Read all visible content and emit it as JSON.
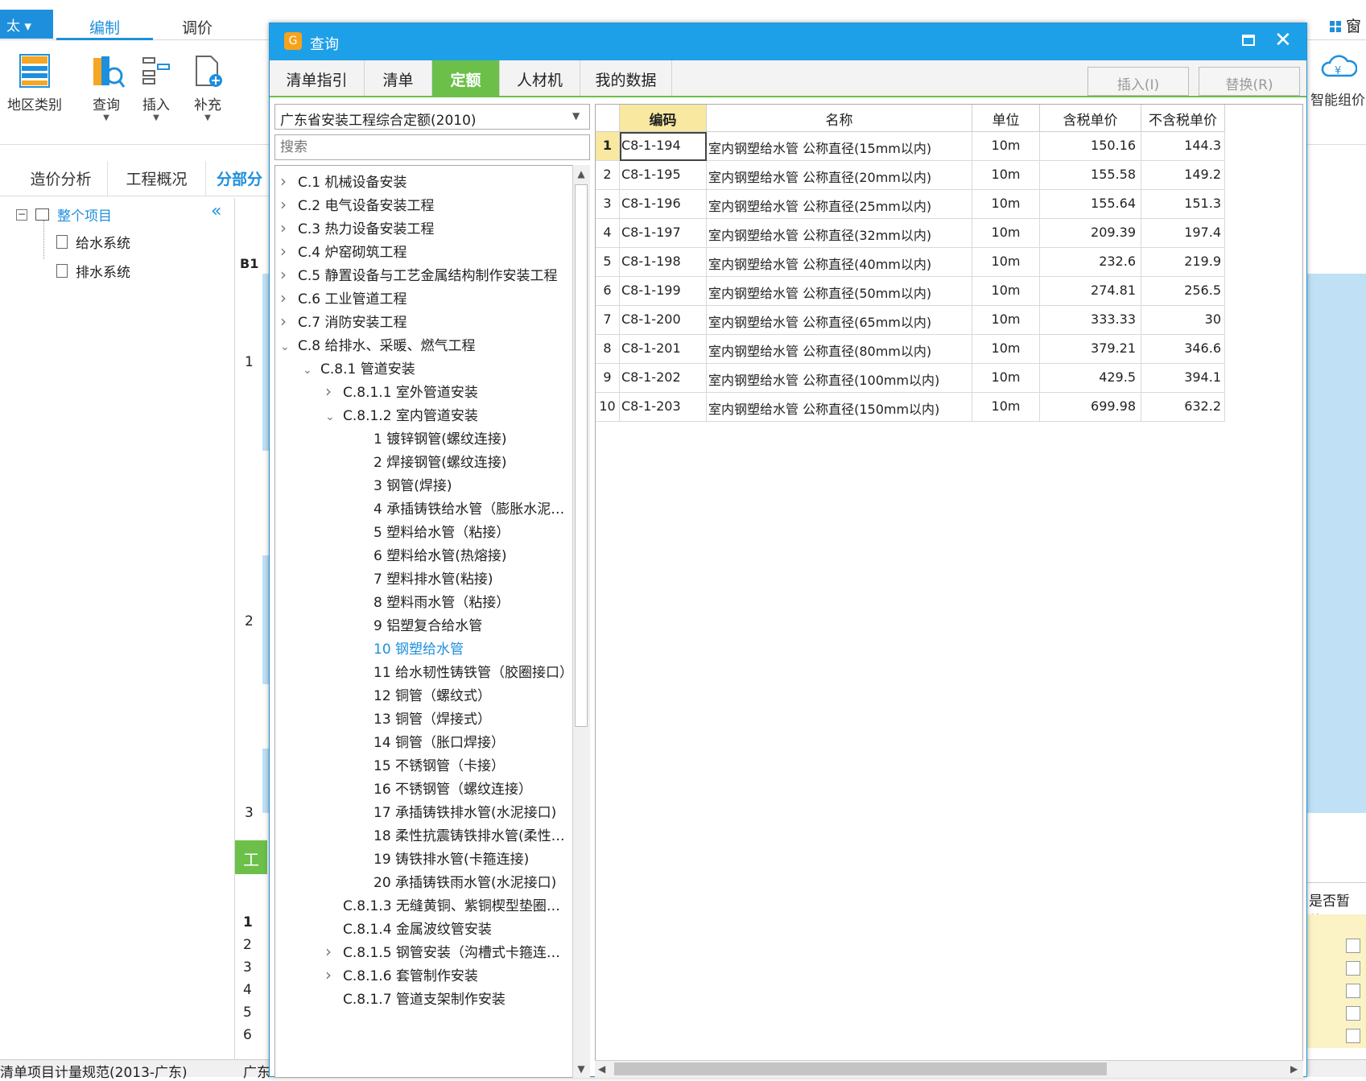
{
  "app": {
    "menu_label": "太 ▾",
    "top_tabs": [
      "编制",
      "调价"
    ],
    "window_label": "窗口",
    "ribbon": {
      "region": "地区类别",
      "query": "查询",
      "insert": "插入",
      "supply": "补充",
      "smart_price": "智能组价"
    },
    "subtabs": [
      "造价分析",
      "工程概况",
      "分部分"
    ],
    "project_tree": {
      "root": "整个项目",
      "children": [
        "给水系统",
        "排水系统"
      ]
    },
    "bg_labels": {
      "b1": "B1",
      "green_tab": "工",
      "right_header": "是否暂估"
    },
    "bg_row_numbers": [
      "1",
      "2",
      "3"
    ],
    "bg_lower_rows": [
      "1",
      "2",
      "3",
      "4",
      "5",
      "6"
    ],
    "status": {
      "spec": "清单项目计量规范(2013-广东)",
      "region": "广东"
    }
  },
  "dialog": {
    "title": "查询",
    "tabs": [
      "清单指引",
      "清单",
      "定额",
      "人材机",
      "我的数据"
    ],
    "active_tab": "定额",
    "buttons": {
      "insert": "插入(I)",
      "replace": "替换(R)"
    },
    "quota_library": "广东省安装工程综合定额(2010)",
    "search_placeholder": "搜索",
    "chapter_tree": [
      {
        "arrow": ">",
        "indent": 0,
        "label": "C.1 机械设备安装"
      },
      {
        "arrow": ">",
        "indent": 0,
        "label": "C.2 电气设备安装工程"
      },
      {
        "arrow": ">",
        "indent": 0,
        "label": "C.3 热力设备安装工程"
      },
      {
        "arrow": ">",
        "indent": 0,
        "label": "C.4 炉窑砌筑工程"
      },
      {
        "arrow": ">",
        "indent": 0,
        "label": "C.5 静置设备与工艺金属结构制作安装工程"
      },
      {
        "arrow": ">",
        "indent": 0,
        "label": "C.6 工业管道工程"
      },
      {
        "arrow": ">",
        "indent": 0,
        "label": "C.7 消防安装工程"
      },
      {
        "arrow": "v",
        "indent": 0,
        "label": "C.8 给排水、采暖、燃气工程"
      },
      {
        "arrow": "v",
        "indent": 1,
        "label": "C.8.1 管道安装"
      },
      {
        "arrow": ">",
        "indent": 2,
        "label": "C.8.1.1 室外管道安装"
      },
      {
        "arrow": "v",
        "indent": 2,
        "label": "C.8.1.2 室内管道安装"
      },
      {
        "arrow": "",
        "indent": 3,
        "label": "1 镀锌钢管(螺纹连接)"
      },
      {
        "arrow": "",
        "indent": 3,
        "label": "2 焊接钢管(螺纹连接)"
      },
      {
        "arrow": "",
        "indent": 3,
        "label": "3 钢管(焊接)"
      },
      {
        "arrow": "",
        "indent": 3,
        "label": "4 承插铸铁给水管（膨胀水泥…"
      },
      {
        "arrow": "",
        "indent": 3,
        "label": "5 塑料给水管（粘接）"
      },
      {
        "arrow": "",
        "indent": 3,
        "label": "6 塑料给水管(热熔接)"
      },
      {
        "arrow": "",
        "indent": 3,
        "label": "7 塑料排水管(粘接)"
      },
      {
        "arrow": "",
        "indent": 3,
        "label": "8 塑料雨水管（粘接）"
      },
      {
        "arrow": "",
        "indent": 3,
        "label": "9 铝塑复合给水管"
      },
      {
        "arrow": "",
        "indent": 3,
        "label": "10 钢塑给水管",
        "selected": true
      },
      {
        "arrow": "",
        "indent": 3,
        "label": "11 给水韧性铸铁管（胶圈接口）"
      },
      {
        "arrow": "",
        "indent": 3,
        "label": "12  铜管（螺纹式）"
      },
      {
        "arrow": "",
        "indent": 3,
        "label": "13 铜管（焊接式）"
      },
      {
        "arrow": "",
        "indent": 3,
        "label": "14 铜管（胀口焊接）"
      },
      {
        "arrow": "",
        "indent": 3,
        "label": "15 不锈钢管（卡接）"
      },
      {
        "arrow": "",
        "indent": 3,
        "label": "16 不锈钢管（螺纹连接）"
      },
      {
        "arrow": "",
        "indent": 3,
        "label": "17 承插铸铁排水管(水泥接口)"
      },
      {
        "arrow": "",
        "indent": 3,
        "label": "18 柔性抗震铸铁排水管(柔性…"
      },
      {
        "arrow": "",
        "indent": 3,
        "label": "19 铸铁排水管(卡箍连接)"
      },
      {
        "arrow": "",
        "indent": 3,
        "label": "20 承插铸铁雨水管(水泥接口)"
      },
      {
        "arrow": "",
        "indent": 2,
        "label": "C.8.1.3 无缝黄铜、紫铜楔型垫圈…"
      },
      {
        "arrow": "",
        "indent": 2,
        "label": "C.8.1.4 金属波纹管安装"
      },
      {
        "arrow": ">",
        "indent": 2,
        "label": "C.8.1.5 钢管安装（沟槽式卡箍连…"
      },
      {
        "arrow": ">",
        "indent": 2,
        "label": "C.8.1.6 套管制作安装"
      },
      {
        "arrow": "",
        "indent": 2,
        "label": "C.8.1.7 管道支架制作安装"
      }
    ],
    "grid": {
      "headers": {
        "code": "编码",
        "name": "名称",
        "unit": "单位",
        "tax_price": "含税单价",
        "notax_price": "不含税单价"
      },
      "rows": [
        {
          "idx": "1",
          "code": "C8-1-194",
          "name": "室内钢塑给水管 公称直径(15mm以内)",
          "unit": "10m",
          "tax": "150.16",
          "notax": "144.3"
        },
        {
          "idx": "2",
          "code": "C8-1-195",
          "name": "室内钢塑给水管 公称直径(20mm以内)",
          "unit": "10m",
          "tax": "155.58",
          "notax": "149.2"
        },
        {
          "idx": "3",
          "code": "C8-1-196",
          "name": "室内钢塑给水管 公称直径(25mm以内)",
          "unit": "10m",
          "tax": "155.64",
          "notax": "151.3"
        },
        {
          "idx": "4",
          "code": "C8-1-197",
          "name": "室内钢塑给水管 公称直径(32mm以内)",
          "unit": "10m",
          "tax": "209.39",
          "notax": "197.4"
        },
        {
          "idx": "5",
          "code": "C8-1-198",
          "name": "室内钢塑给水管 公称直径(40mm以内)",
          "unit": "10m",
          "tax": "232.6",
          "notax": "219.9"
        },
        {
          "idx": "6",
          "code": "C8-1-199",
          "name": "室内钢塑给水管 公称直径(50mm以内)",
          "unit": "10m",
          "tax": "274.81",
          "notax": "256.5"
        },
        {
          "idx": "7",
          "code": "C8-1-200",
          "name": "室内钢塑给水管 公称直径(65mm以内)",
          "unit": "10m",
          "tax": "333.33",
          "notax": "30"
        },
        {
          "idx": "8",
          "code": "C8-1-201",
          "name": "室内钢塑给水管 公称直径(80mm以内)",
          "unit": "10m",
          "tax": "379.21",
          "notax": "346.6"
        },
        {
          "idx": "9",
          "code": "C8-1-202",
          "name": "室内钢塑给水管 公称直径(100mm以内)",
          "unit": "10m",
          "tax": "429.5",
          "notax": "394.1"
        },
        {
          "idx": "10",
          "code": "C8-1-203",
          "name": "室内钢塑给水管 公称直径(150mm以内)",
          "unit": "10m",
          "tax": "699.98",
          "notax": "632.2"
        }
      ]
    }
  },
  "colors": {
    "accent": "#1e8fdc",
    "title_bar": "#1ea0e8",
    "active_tab": "#6cc04a",
    "header_highlight": "#f8e8a0"
  }
}
